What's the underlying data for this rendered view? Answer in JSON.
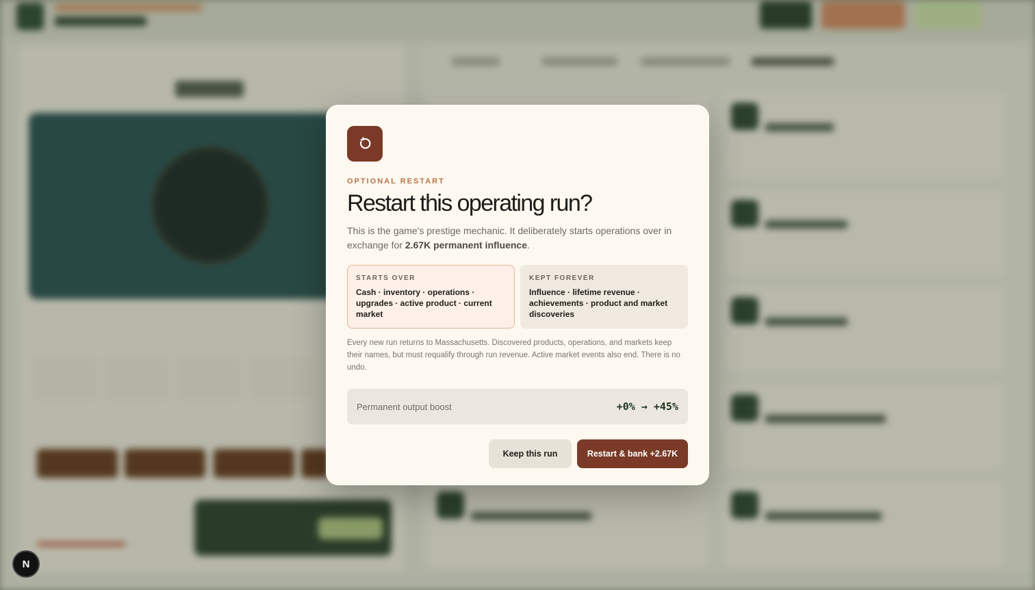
{
  "modal": {
    "icon": "restart-icon",
    "eyebrow": "OPTIONAL RESTART",
    "title": "Restart this operating run?",
    "description_before": "This is the game's prestige mechanic. It deliberately starts operations over in exchange for ",
    "description_bold": "2.67K permanent influence",
    "description_after": ".",
    "starts_over": {
      "heading": "STARTS OVER",
      "body": "Cash · inventory · operations · upgrades · active product · current market"
    },
    "kept_forever": {
      "heading": "KEPT FOREVER",
      "body": "Influence · lifetime revenue · achievements · product and market discoveries"
    },
    "note": "Every new run returns to Massachusetts. Discovered products, operations, and markets keep their names, but must requalify through run revenue. Active market events also end. There is no undo.",
    "boost": {
      "label": "Permanent output boost",
      "value": "+0% → +45%"
    },
    "keep_button": "Keep this run",
    "restart_button": "Restart & bank +2.67K"
  },
  "corner_badge": "N",
  "colors": {
    "accent": "#7a3a27",
    "eyebrow": "#b9734a",
    "modal_bg": "#fdf8f0"
  }
}
